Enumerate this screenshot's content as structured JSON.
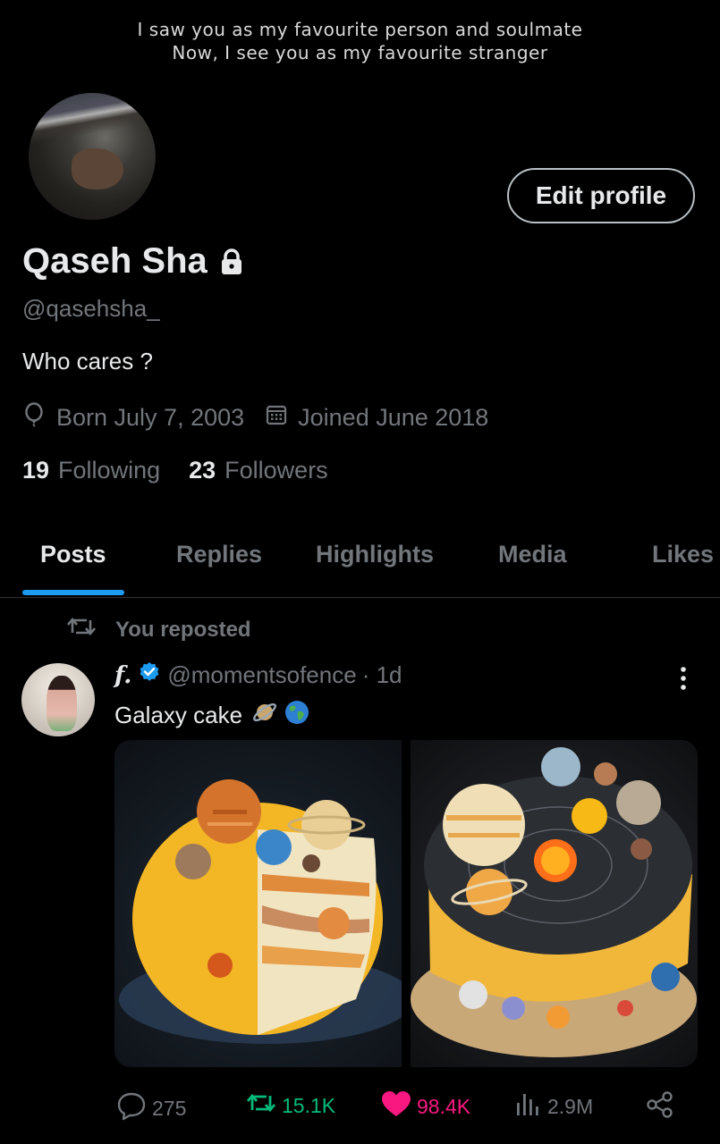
{
  "banner": {
    "line1": "I saw you as my favourite person and soulmate",
    "line2": "Now, I see you as my favourite stranger"
  },
  "profile": {
    "edit_label": "Edit profile",
    "name": "Qaseh Sha",
    "handle": "@qasehsha_",
    "bio": "Who cares ?",
    "born": "Born July 7, 2003",
    "joined": "Joined June 2018",
    "following_count": "19",
    "following_label": "Following",
    "followers_count": "23",
    "followers_label": "Followers"
  },
  "tabs": [
    {
      "label": "Posts"
    },
    {
      "label": "Replies"
    },
    {
      "label": "Highlights"
    },
    {
      "label": "Media"
    },
    {
      "label": "Likes"
    }
  ],
  "post": {
    "repost_label": "You reposted",
    "author_name": "f.",
    "author_handle": "@momentsofence",
    "time": "· 1d",
    "text": "Galaxy cake",
    "emojis": [
      "ringed-planet-icon",
      "globe-icon"
    ],
    "replies": "275",
    "reposts": "15.1K",
    "likes": "98.4K",
    "views": "2.9M"
  },
  "colors": {
    "accent": "#1d9bf0",
    "repost_green": "#00ba7c",
    "like_pink": "#f91880",
    "muted": "#71767b",
    "text": "#e7e9ea"
  }
}
